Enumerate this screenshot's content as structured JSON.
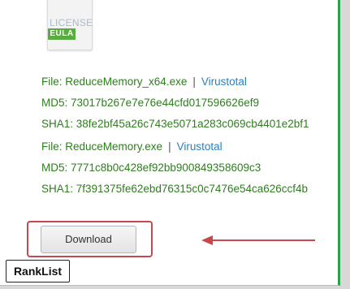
{
  "license_icon": {
    "label": "LICENSE",
    "badge": "EULA"
  },
  "files": [
    {
      "file_label": "File: ReduceMemory_x64.exe",
      "separator": "|",
      "link_label": "Virustotal",
      "md5": "MD5: 73017b267e7e76e44cfd017596626ef9",
      "sha1": "SHA1: 38fe2bf45a26c743e5071a283c069cb4401e2bf1"
    },
    {
      "file_label": "File: ReduceMemory.exe",
      "separator": "|",
      "link_label": "Virustotal",
      "md5": "MD5: 7771c8b0c428ef92bb900849358609c3",
      "sha1": "SHA1: 7f391375fe62ebd76315c0c7476e54ca626ccf4b"
    }
  ],
  "download_button": {
    "label": "Download"
  },
  "ranklist_button": {
    "label": "RankList"
  },
  "colors": {
    "accent_green": "#2aa14a",
    "text_green": "#2e7d1f",
    "link_blue": "#2a7fc1",
    "highlight_red": "#c8484e"
  }
}
